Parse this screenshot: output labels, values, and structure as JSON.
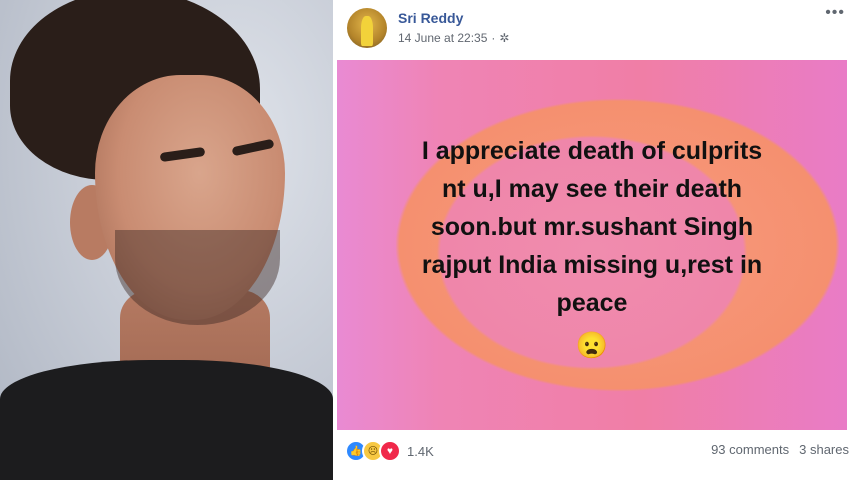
{
  "post": {
    "author": "Sri Reddy",
    "timestamp": "14 June at 22:35",
    "separator": "·",
    "more_icon": "more-icon",
    "privacy_icon": "gear-icon",
    "text_lines": [
      "I appreciate death of culprits",
      "nt u,I may see their death",
      "soon.but mr.sushant Singh",
      "rajput India missing u,rest in",
      "peace"
    ],
    "emoji": "😦",
    "reaction_count": "1.4K",
    "comments": "93 comments",
    "shares": "3 shares"
  },
  "colors": {
    "author_link": "#385898",
    "meta_text": "#616770",
    "card_pink": "#f07ea6",
    "card_orange": "#f5906f",
    "like": "#2e89ff",
    "love": "#f0284a",
    "sad": "#f7c843"
  }
}
